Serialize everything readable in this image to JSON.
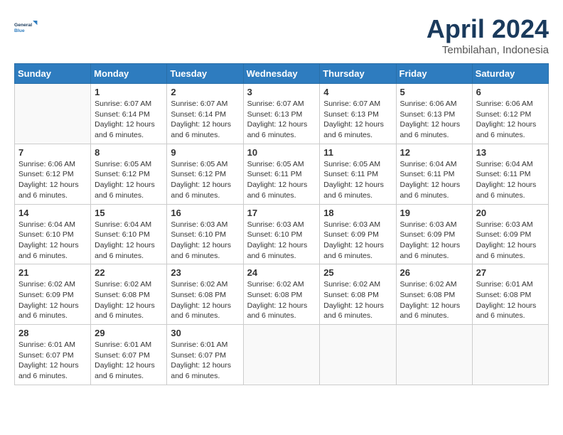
{
  "header": {
    "logo_line1": "General",
    "logo_line2": "Blue",
    "month_year": "April 2024",
    "location": "Tembilahan, Indonesia"
  },
  "days_of_week": [
    "Sunday",
    "Monday",
    "Tuesday",
    "Wednesday",
    "Thursday",
    "Friday",
    "Saturday"
  ],
  "weeks": [
    [
      null,
      {
        "day": "1",
        "sunrise": "6:07 AM",
        "sunset": "6:14 PM",
        "daylight": "12 hours and 6 minutes."
      },
      {
        "day": "2",
        "sunrise": "6:07 AM",
        "sunset": "6:14 PM",
        "daylight": "12 hours and 6 minutes."
      },
      {
        "day": "3",
        "sunrise": "6:07 AM",
        "sunset": "6:13 PM",
        "daylight": "12 hours and 6 minutes."
      },
      {
        "day": "4",
        "sunrise": "6:07 AM",
        "sunset": "6:13 PM",
        "daylight": "12 hours and 6 minutes."
      },
      {
        "day": "5",
        "sunrise": "6:06 AM",
        "sunset": "6:13 PM",
        "daylight": "12 hours and 6 minutes."
      },
      {
        "day": "6",
        "sunrise": "6:06 AM",
        "sunset": "6:12 PM",
        "daylight": "12 hours and 6 minutes."
      }
    ],
    [
      {
        "day": "7",
        "sunrise": "6:06 AM",
        "sunset": "6:12 PM",
        "daylight": "12 hours and 6 minutes."
      },
      {
        "day": "8",
        "sunrise": "6:05 AM",
        "sunset": "6:12 PM",
        "daylight": "12 hours and 6 minutes."
      },
      {
        "day": "9",
        "sunrise": "6:05 AM",
        "sunset": "6:12 PM",
        "daylight": "12 hours and 6 minutes."
      },
      {
        "day": "10",
        "sunrise": "6:05 AM",
        "sunset": "6:11 PM",
        "daylight": "12 hours and 6 minutes."
      },
      {
        "day": "11",
        "sunrise": "6:05 AM",
        "sunset": "6:11 PM",
        "daylight": "12 hours and 6 minutes."
      },
      {
        "day": "12",
        "sunrise": "6:04 AM",
        "sunset": "6:11 PM",
        "daylight": "12 hours and 6 minutes."
      },
      {
        "day": "13",
        "sunrise": "6:04 AM",
        "sunset": "6:11 PM",
        "daylight": "12 hours and 6 minutes."
      }
    ],
    [
      {
        "day": "14",
        "sunrise": "6:04 AM",
        "sunset": "6:10 PM",
        "daylight": "12 hours and 6 minutes."
      },
      {
        "day": "15",
        "sunrise": "6:04 AM",
        "sunset": "6:10 PM",
        "daylight": "12 hours and 6 minutes."
      },
      {
        "day": "16",
        "sunrise": "6:03 AM",
        "sunset": "6:10 PM",
        "daylight": "12 hours and 6 minutes."
      },
      {
        "day": "17",
        "sunrise": "6:03 AM",
        "sunset": "6:10 PM",
        "daylight": "12 hours and 6 minutes."
      },
      {
        "day": "18",
        "sunrise": "6:03 AM",
        "sunset": "6:09 PM",
        "daylight": "12 hours and 6 minutes."
      },
      {
        "day": "19",
        "sunrise": "6:03 AM",
        "sunset": "6:09 PM",
        "daylight": "12 hours and 6 minutes."
      },
      {
        "day": "20",
        "sunrise": "6:03 AM",
        "sunset": "6:09 PM",
        "daylight": "12 hours and 6 minutes."
      }
    ],
    [
      {
        "day": "21",
        "sunrise": "6:02 AM",
        "sunset": "6:09 PM",
        "daylight": "12 hours and 6 minutes."
      },
      {
        "day": "22",
        "sunrise": "6:02 AM",
        "sunset": "6:08 PM",
        "daylight": "12 hours and 6 minutes."
      },
      {
        "day": "23",
        "sunrise": "6:02 AM",
        "sunset": "6:08 PM",
        "daylight": "12 hours and 6 minutes."
      },
      {
        "day": "24",
        "sunrise": "6:02 AM",
        "sunset": "6:08 PM",
        "daylight": "12 hours and 6 minutes."
      },
      {
        "day": "25",
        "sunrise": "6:02 AM",
        "sunset": "6:08 PM",
        "daylight": "12 hours and 6 minutes."
      },
      {
        "day": "26",
        "sunrise": "6:02 AM",
        "sunset": "6:08 PM",
        "daylight": "12 hours and 6 minutes."
      },
      {
        "day": "27",
        "sunrise": "6:01 AM",
        "sunset": "6:08 PM",
        "daylight": "12 hours and 6 minutes."
      }
    ],
    [
      {
        "day": "28",
        "sunrise": "6:01 AM",
        "sunset": "6:07 PM",
        "daylight": "12 hours and 6 minutes."
      },
      {
        "day": "29",
        "sunrise": "6:01 AM",
        "sunset": "6:07 PM",
        "daylight": "12 hours and 6 minutes."
      },
      {
        "day": "30",
        "sunrise": "6:01 AM",
        "sunset": "6:07 PM",
        "daylight": "12 hours and 6 minutes."
      },
      null,
      null,
      null,
      null
    ]
  ]
}
